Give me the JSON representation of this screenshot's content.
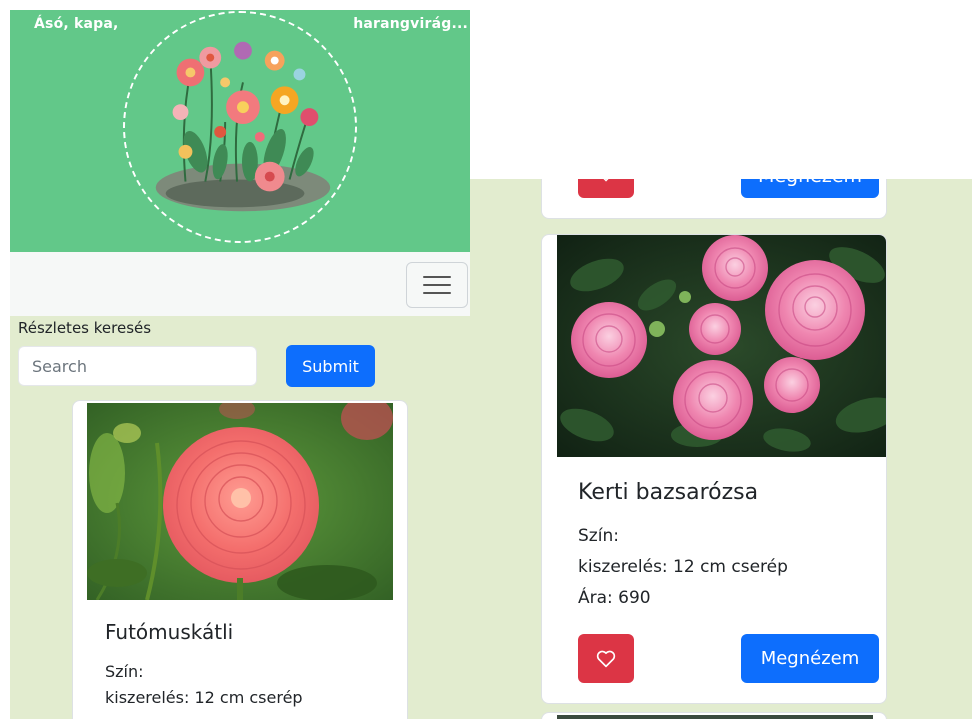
{
  "header": {
    "tagline_left": "Ásó, kapa,",
    "tagline_right": "harangvirág..."
  },
  "colors": {
    "header_bg": "#62c889",
    "page_bg": "#e2eccf",
    "primary": "#0d6efd",
    "danger": "#dc3545"
  },
  "search": {
    "label": "Részletes keresés",
    "placeholder": "Search",
    "submit_label": "Submit"
  },
  "cards": [
    {
      "title": "Futómuskátli",
      "color_label": "Szín:",
      "packaging": "kiszerelés: 12 cm cserép",
      "image_icon": "dahlia-photo"
    },
    {
      "title": "Kerti bazsarózsa",
      "color_label": "Szín:",
      "packaging": "kiszerelés: 12 cm cserép",
      "price": "Ára: 690",
      "view_label": "Megnézem",
      "favorite_icon": "heart-icon",
      "image_icon": "roses-photo"
    }
  ],
  "previous_card": {
    "view_label": "Megnézem"
  }
}
